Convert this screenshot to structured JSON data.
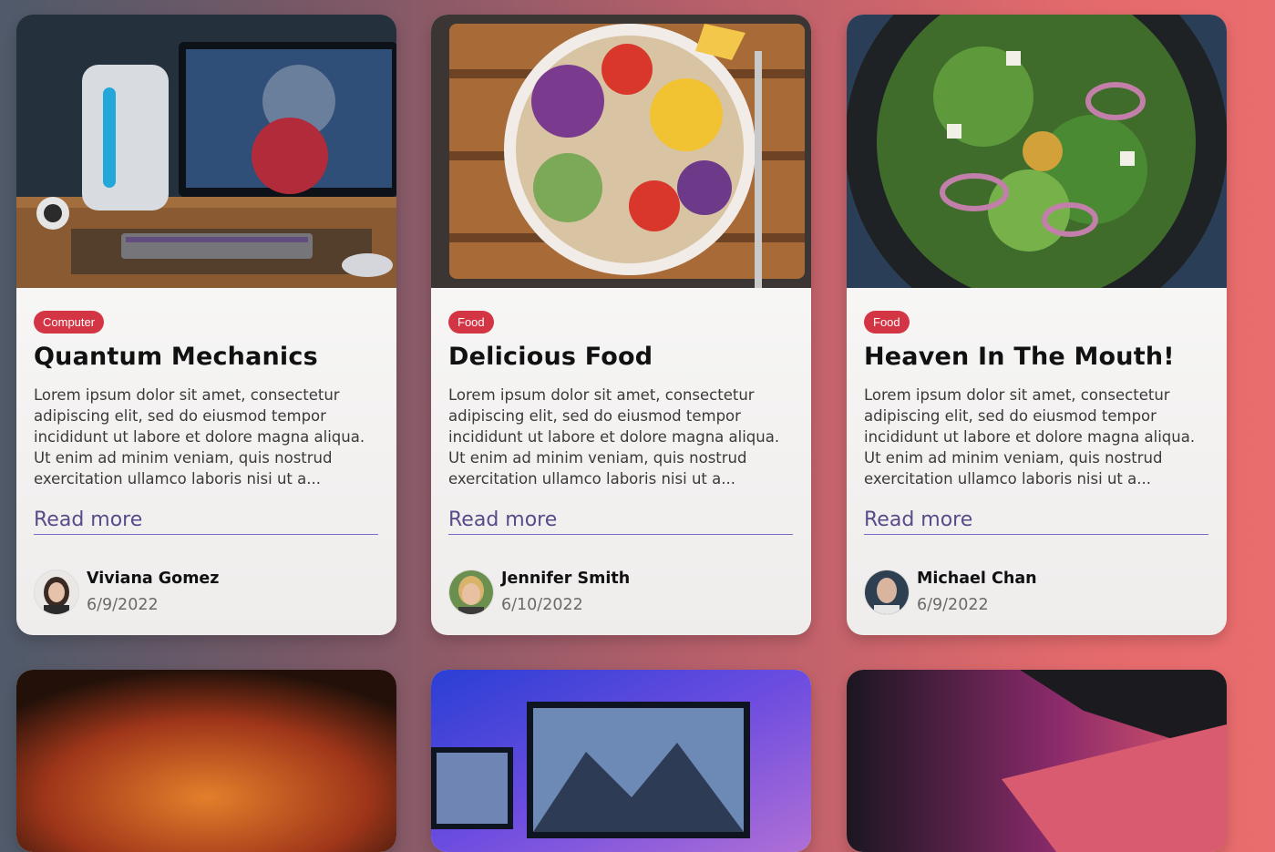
{
  "cards": [
    {
      "tag": "Computer",
      "title": "Quantum Mechanics",
      "body": "Lorem ipsum dolor sit amet, consectetur adipiscing elit, sed do eiusmod tempor incididunt ut labore et dolore magna aliqua. Ut enim ad minim veniam, quis nostrud exercitation ullamco laboris nisi ut a...",
      "link": "Read more",
      "author": "Viviana Gomez",
      "date": "6/9/2022"
    },
    {
      "tag": "Food",
      "title": "Delicious Food",
      "body": "Lorem ipsum dolor sit amet, consectetur adipiscing elit, sed do eiusmod tempor incididunt ut labore et dolore magna aliqua. Ut enim ad minim veniam, quis nostrud exercitation ullamco laboris nisi ut a...",
      "link": "Read more",
      "author": "Jennifer Smith",
      "date": "6/10/2022"
    },
    {
      "tag": "Food",
      "title": "Heaven In The Mouth!",
      "body": "Lorem ipsum dolor sit amet, consectetur adipiscing elit, sed do eiusmod tempor incididunt ut labore et dolore magna aliqua. Ut enim ad minim veniam, quis nostrud exercitation ullamco laboris nisi ut a...",
      "link": "Read more",
      "author": "Michael Chan",
      "date": "6/9/2022"
    }
  ],
  "colors": {
    "tag_bg": "#d43545",
    "link": "#5a4a8a"
  }
}
